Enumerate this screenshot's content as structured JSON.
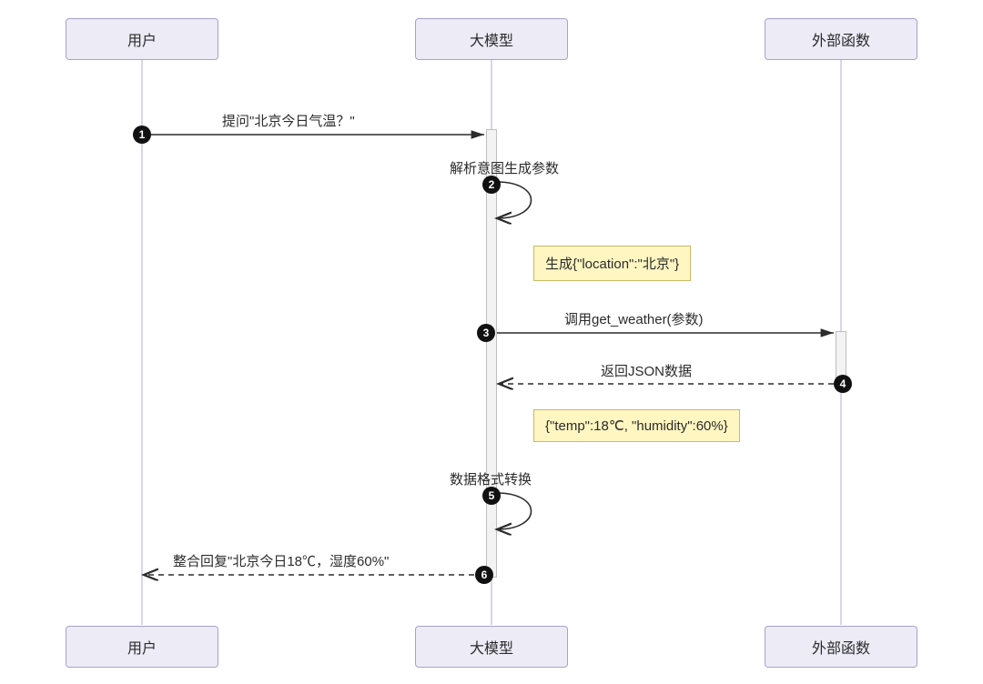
{
  "actors": {
    "user": "用户",
    "model": "大模型",
    "external": "外部函数"
  },
  "messages": {
    "m1": "提问\"北京今日气温？\"",
    "m2": "解析意图生成参数",
    "m3": "调用get_weather(参数)",
    "m4": "返回JSON数据",
    "m5": "数据格式转换",
    "m6": "整合回复\"北京今日18℃，湿度60%\""
  },
  "notes": {
    "n1": "生成{\"location\":\"北京\"}",
    "n2": "{\"temp\":18℃, \"humidity\":60%}"
  },
  "steps": {
    "s1": "1",
    "s2": "2",
    "s3": "3",
    "s4": "4",
    "s5": "5",
    "s6": "6"
  }
}
